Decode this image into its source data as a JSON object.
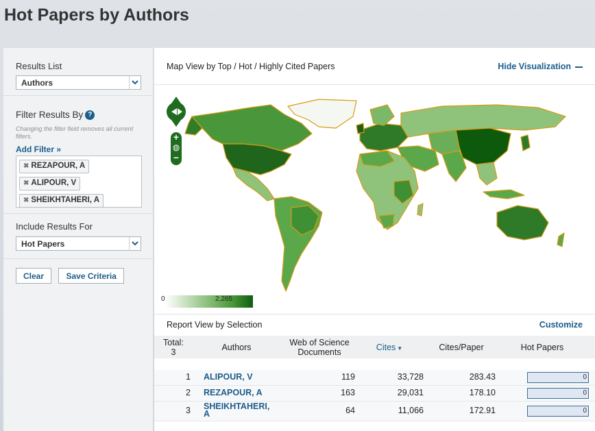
{
  "page": {
    "title": "Hot Papers by Authors"
  },
  "sidebar": {
    "results_list": {
      "label": "Results List",
      "value": "Authors"
    },
    "filter": {
      "label": "Filter Results By",
      "hint": "Changing the filter field removes all current filters.",
      "add_filter": "Add Filter »",
      "chips": [
        "REZAPOUR, A",
        "ALIPOUR, V",
        "SHEIKHTAHERI, A"
      ]
    },
    "include": {
      "label": "Include Results For",
      "value": "Hot Papers"
    },
    "buttons": {
      "clear": "Clear",
      "save": "Save Criteria"
    }
  },
  "map": {
    "title": "Map View by Top / Hot / Highly Cited Papers",
    "hide": "Hide Visualization",
    "legend_min": "0",
    "legend_max": "2,265",
    "colors": {
      "light": "#c9e3b9",
      "mid": "#5aa84a",
      "dark": "#1d6f1d",
      "darkest": "#0d5a0d",
      "border": "#d89a14"
    }
  },
  "report": {
    "title": "Report View by Selection",
    "customize": "Customize",
    "headers": {
      "total_label": "Total:",
      "total_value": "3",
      "authors": "Authors",
      "wos": "Web of Science Documents",
      "cites": "Cites",
      "cites_paper": "Cites/Paper",
      "hot_papers": "Hot Papers"
    },
    "rows": [
      {
        "rank": "1",
        "author": "ALIPOUR, V",
        "docs": "119",
        "cites": "33,728",
        "cpp": "283.43",
        "hot": "0"
      },
      {
        "rank": "2",
        "author": "REZAPOUR, A",
        "docs": "163",
        "cites": "29,031",
        "cpp": "178.10",
        "hot": "0"
      },
      {
        "rank": "3",
        "author": "SHEIKHTAHERI, A",
        "docs": "64",
        "cites": "11,066",
        "cpp": "172.91",
        "hot": "0"
      }
    ]
  }
}
